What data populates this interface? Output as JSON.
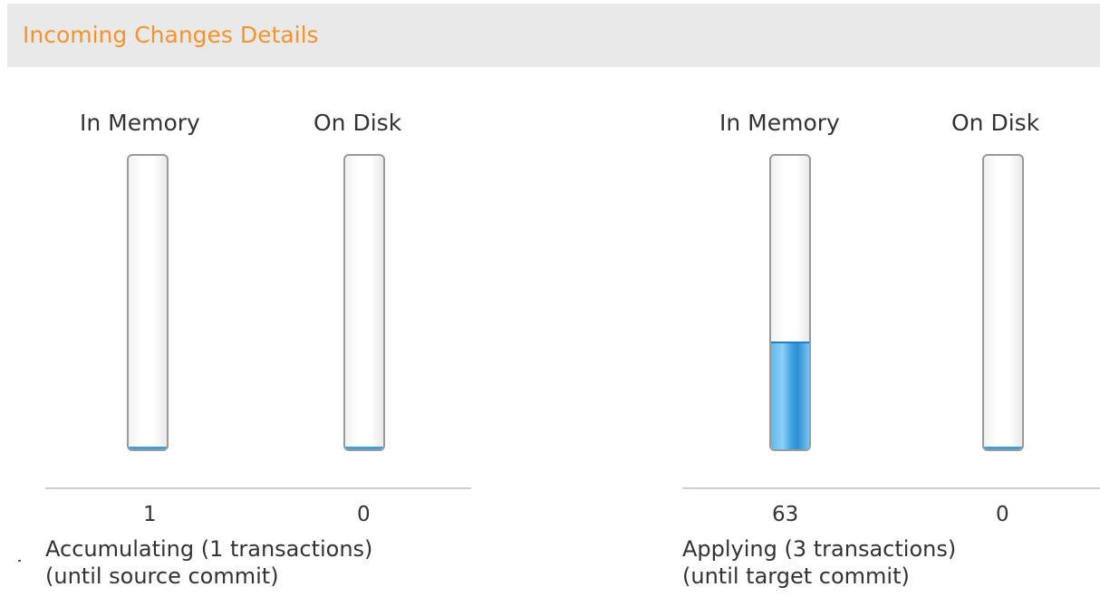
{
  "header": {
    "title": "Incoming Changes Details"
  },
  "accumulating": {
    "in_memory_label": "In Memory",
    "on_disk_label": "On Disk",
    "in_memory_value": "1",
    "on_disk_value": "0",
    "in_memory_fill": 0,
    "on_disk_fill": 0,
    "status": "Accumulating (1 transactions)",
    "status_note": "(until source commit)"
  },
  "applying": {
    "in_memory_label": "In Memory",
    "on_disk_label": "On Disk",
    "in_memory_value": "63",
    "on_disk_value": "0",
    "in_memory_fill": 0.36,
    "on_disk_fill": 0,
    "status": "Applying (3 transactions)",
    "status_note": "(until target commit)"
  },
  "colors": {
    "header_title": "#f7932b",
    "header_bg": "#e9e9e9",
    "gauge_fill": "#3b9fdf"
  }
}
